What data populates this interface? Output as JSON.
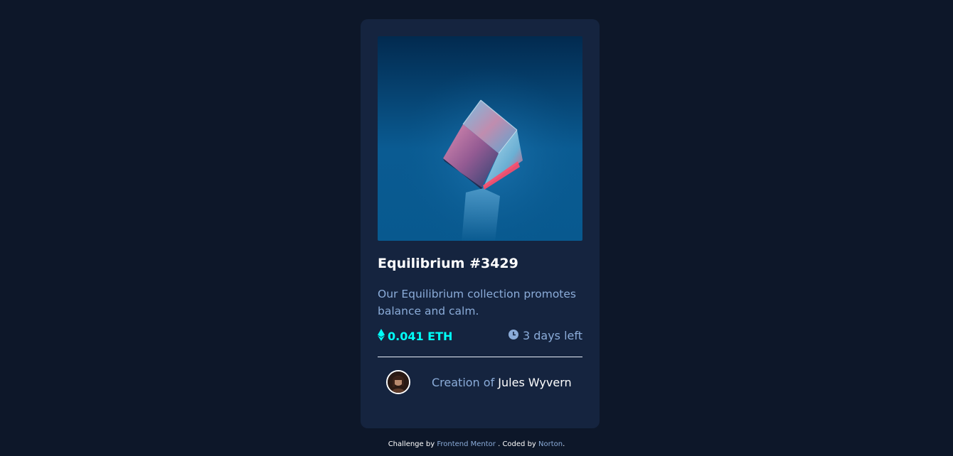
{
  "card": {
    "title": "Equilibrium #3429",
    "description": "Our Equilibrium collection promotes balance and calm.",
    "price": "0.041 ETH",
    "time_left": "3 days left",
    "creator_prefix": "Creation of",
    "creator_name": "Jules Wyvern"
  },
  "footer": {
    "prefix": "Challenge by",
    "challenge_link": "Frontend Mentor",
    "middle": ". Coded by",
    "author_link": "Norton",
    "suffix": "."
  },
  "colors": {
    "page_bg": "#0d1729",
    "card_bg": "#15243f",
    "accent_cyan": "#00fff8",
    "soft_blue": "#8bacd9",
    "white": "#ffffff"
  },
  "icons": {
    "price": "ethereum-icon",
    "time": "clock-icon"
  }
}
